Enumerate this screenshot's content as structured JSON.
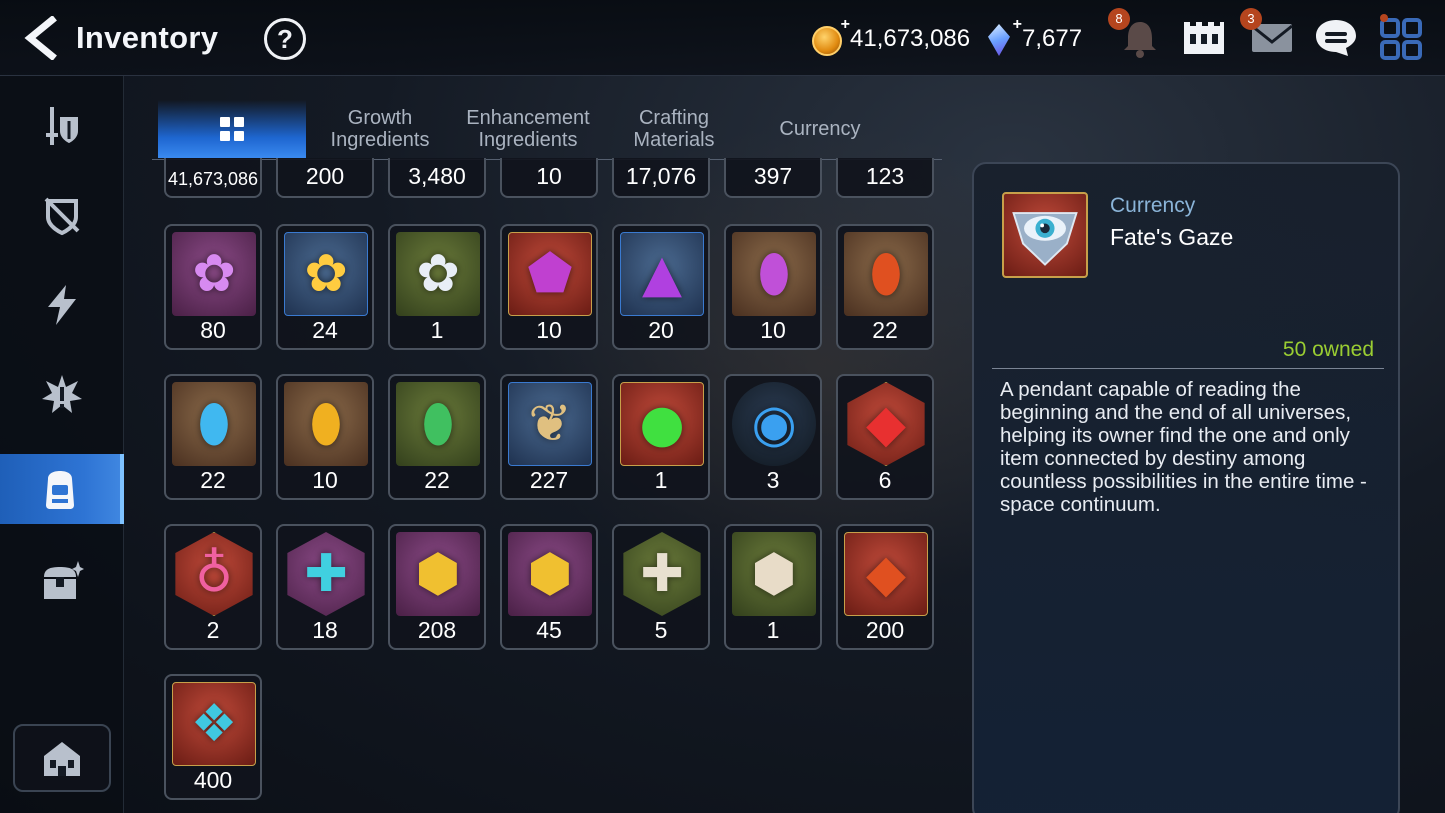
{
  "header": {
    "title": "Inventory",
    "help_label": "?",
    "gold": "41,673,086",
    "crystals": "7,677",
    "notifications_badge": "8",
    "mail_badge": "3"
  },
  "sidebar": {
    "items": [
      "equipment",
      "artifact",
      "skill",
      "catalyst",
      "materials",
      "chest"
    ],
    "active": "materials"
  },
  "tabs": [
    {
      "label": "",
      "icon": "grid-icon",
      "active": true
    },
    {
      "label": "Growth\nIngredients",
      "active": false
    },
    {
      "label": "Enhancement\nIngredients",
      "active": false
    },
    {
      "label": "Crafting\nMaterials",
      "active": false
    },
    {
      "label": "Currency",
      "active": false
    }
  ],
  "items": {
    "row0": [
      "41,673,086",
      "200",
      "3,480",
      "10",
      "17,076",
      "397",
      "123"
    ],
    "row1": [
      {
        "qty": "80",
        "icon": "purple-flower-icon",
        "bg": "purple"
      },
      {
        "qty": "24",
        "icon": "gold-flower-icon",
        "bg": "blue"
      },
      {
        "qty": "1",
        "icon": "silver-flower-icon",
        "bg": "green"
      },
      {
        "qty": "10",
        "icon": "purple-moon-pentagon-icon",
        "bg": "red"
      },
      {
        "qty": "20",
        "icon": "purple-moon-triangle-icon",
        "bg": "blue"
      },
      {
        "qty": "10",
        "icon": "purple-moon-oval-icon",
        "bg": "brown"
      },
      {
        "qty": "22",
        "icon": "fire-rune-icon",
        "bg": "brown"
      }
    ],
    "row2": [
      {
        "qty": "22",
        "icon": "ice-rune-icon",
        "bg": "brown"
      },
      {
        "qty": "10",
        "icon": "earth-rune-icon",
        "bg": "brown"
      },
      {
        "qty": "22",
        "icon": "wind-rune-icon",
        "bg": "green"
      },
      {
        "qty": "227",
        "icon": "ginseng-root-icon",
        "bg": "blue"
      },
      {
        "qty": "1",
        "icon": "green-orb-icon",
        "bg": "red"
      },
      {
        "qty": "3",
        "icon": "blue-circuit-disc-icon",
        "bg": "dark"
      },
      {
        "qty": "6",
        "icon": "red-gem-hex-icon",
        "bg": "red"
      }
    ],
    "row3": [
      {
        "qty": "2",
        "icon": "pink-potion-icon",
        "bg": "red"
      },
      {
        "qty": "18",
        "icon": "cyan-cross-stone-icon",
        "bg": "purple"
      },
      {
        "qty": "208",
        "icon": "yellow-rune-stone-icon",
        "bg": "purple"
      },
      {
        "qty": "45",
        "icon": "yellow-rune-stone-icon",
        "bg": "purple"
      },
      {
        "qty": "5",
        "icon": "white-cross-stone-icon",
        "bg": "green"
      },
      {
        "qty": "1",
        "icon": "white-rune-stone-icon",
        "bg": "green"
      },
      {
        "qty": "200",
        "icon": "dark-fire-crystal-icon",
        "bg": "red"
      }
    ],
    "row4": [
      {
        "qty": "400",
        "icon": "blue-crystal-shard-icon",
        "bg": "red"
      }
    ]
  },
  "detail": {
    "category": "Currency",
    "name": "Fate's Gaze",
    "owned": "50 owned",
    "description": "A pendant capable of reading the beginning and the end of all universes, helping its owner find the one and only item connected by destiny among countless possibilities in the entire time -space continuum."
  },
  "colors": {
    "accent_blue": "#2e74d4",
    "owned_green": "#9acd32",
    "category_blue": "#8ab4d8"
  }
}
